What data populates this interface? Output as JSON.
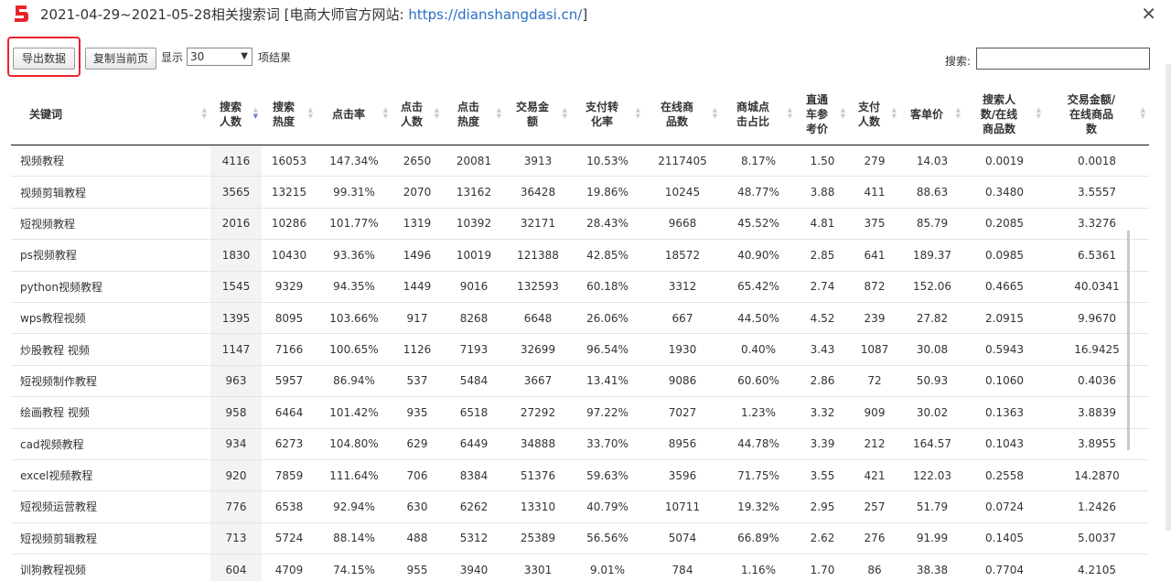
{
  "window": {
    "title_prefix": "2021-04-29~2021-05-28相关搜索词 [电商大师官方网站:",
    "title_url": "https://dianshangdasi.cn/",
    "title_suffix": "]",
    "brand_color": "#e8252a"
  },
  "toolbar": {
    "export_label": "导出数据",
    "copy_label": "复制当前页",
    "show_label": "显示",
    "page_size": "30",
    "items_label": "项结果",
    "search_label": "搜索:",
    "search_value": ""
  },
  "table": {
    "headers": [
      "关键词",
      "搜索人数",
      "搜索热度",
      "点击率",
      "点击人数",
      "点击热度",
      "交易金额",
      "支付转化率",
      "在线商品数",
      "商城点击占比",
      "直通车参考价",
      "支付人数",
      "客单价",
      "搜索人数/在线商品数",
      "交易金额/在线商品数"
    ],
    "rows": [
      [
        "视频教程",
        "4116",
        "16053",
        "147.34%",
        "2650",
        "20081",
        "3913",
        "10.53%",
        "2117405",
        "8.17%",
        "1.50",
        "279",
        "14.03",
        "0.0019",
        "0.0018"
      ],
      [
        "视频剪辑教程",
        "3565",
        "13215",
        "99.31%",
        "2070",
        "13162",
        "36428",
        "19.86%",
        "10245",
        "48.77%",
        "3.88",
        "411",
        "88.63",
        "0.3480",
        "3.5557"
      ],
      [
        "短视频教程",
        "2016",
        "10286",
        "101.77%",
        "1319",
        "10392",
        "32171",
        "28.43%",
        "9668",
        "45.52%",
        "4.81",
        "375",
        "85.79",
        "0.2085",
        "3.3276"
      ],
      [
        "ps视频教程",
        "1830",
        "10430",
        "93.36%",
        "1496",
        "10019",
        "121388",
        "42.85%",
        "18572",
        "40.90%",
        "2.85",
        "641",
        "189.37",
        "0.0985",
        "6.5361"
      ],
      [
        "python视频教程",
        "1545",
        "9329",
        "94.35%",
        "1449",
        "9016",
        "132593",
        "60.18%",
        "3312",
        "65.42%",
        "2.74",
        "872",
        "152.06",
        "0.4665",
        "40.0341"
      ],
      [
        "wps教程视频",
        "1395",
        "8095",
        "103.66%",
        "917",
        "8268",
        "6648",
        "26.06%",
        "667",
        "44.50%",
        "4.52",
        "239",
        "27.82",
        "2.0915",
        "9.9670"
      ],
      [
        "炒股教程 视频",
        "1147",
        "7166",
        "100.65%",
        "1126",
        "7193",
        "32699",
        "96.54%",
        "1930",
        "0.40%",
        "3.43",
        "1087",
        "30.08",
        "0.5943",
        "16.9425"
      ],
      [
        "短视频制作教程",
        "963",
        "5957",
        "86.94%",
        "537",
        "5484",
        "3667",
        "13.41%",
        "9086",
        "60.60%",
        "2.86",
        "72",
        "50.93",
        "0.1060",
        "0.4036"
      ],
      [
        "绘画教程 视频",
        "958",
        "6464",
        "101.42%",
        "935",
        "6518",
        "27292",
        "97.22%",
        "7027",
        "1.23%",
        "3.32",
        "909",
        "30.02",
        "0.1363",
        "3.8839"
      ],
      [
        "cad视频教程",
        "934",
        "6273",
        "104.80%",
        "629",
        "6449",
        "34888",
        "33.70%",
        "8956",
        "44.78%",
        "3.39",
        "212",
        "164.57",
        "0.1043",
        "3.8955"
      ],
      [
        "excel视频教程",
        "920",
        "7859",
        "111.64%",
        "706",
        "8384",
        "51376",
        "59.63%",
        "3596",
        "71.75%",
        "3.55",
        "421",
        "122.03",
        "0.2558",
        "14.2870"
      ],
      [
        "短视频运营教程",
        "776",
        "6538",
        "92.94%",
        "630",
        "6262",
        "13310",
        "40.79%",
        "10711",
        "19.32%",
        "2.95",
        "257",
        "51.79",
        "0.0724",
        "1.2426"
      ],
      [
        "短视频剪辑教程",
        "713",
        "5724",
        "88.14%",
        "488",
        "5312",
        "25389",
        "56.56%",
        "5074",
        "66.89%",
        "2.62",
        "276",
        "91.99",
        "0.1405",
        "5.0037"
      ],
      [
        "训狗教程视频",
        "604",
        "4709",
        "74.15%",
        "955",
        "3940",
        "3301",
        "9.01%",
        "784",
        "1.16%",
        "1.70",
        "86",
        "38.38",
        "0.7704",
        "4.2105"
      ]
    ]
  }
}
